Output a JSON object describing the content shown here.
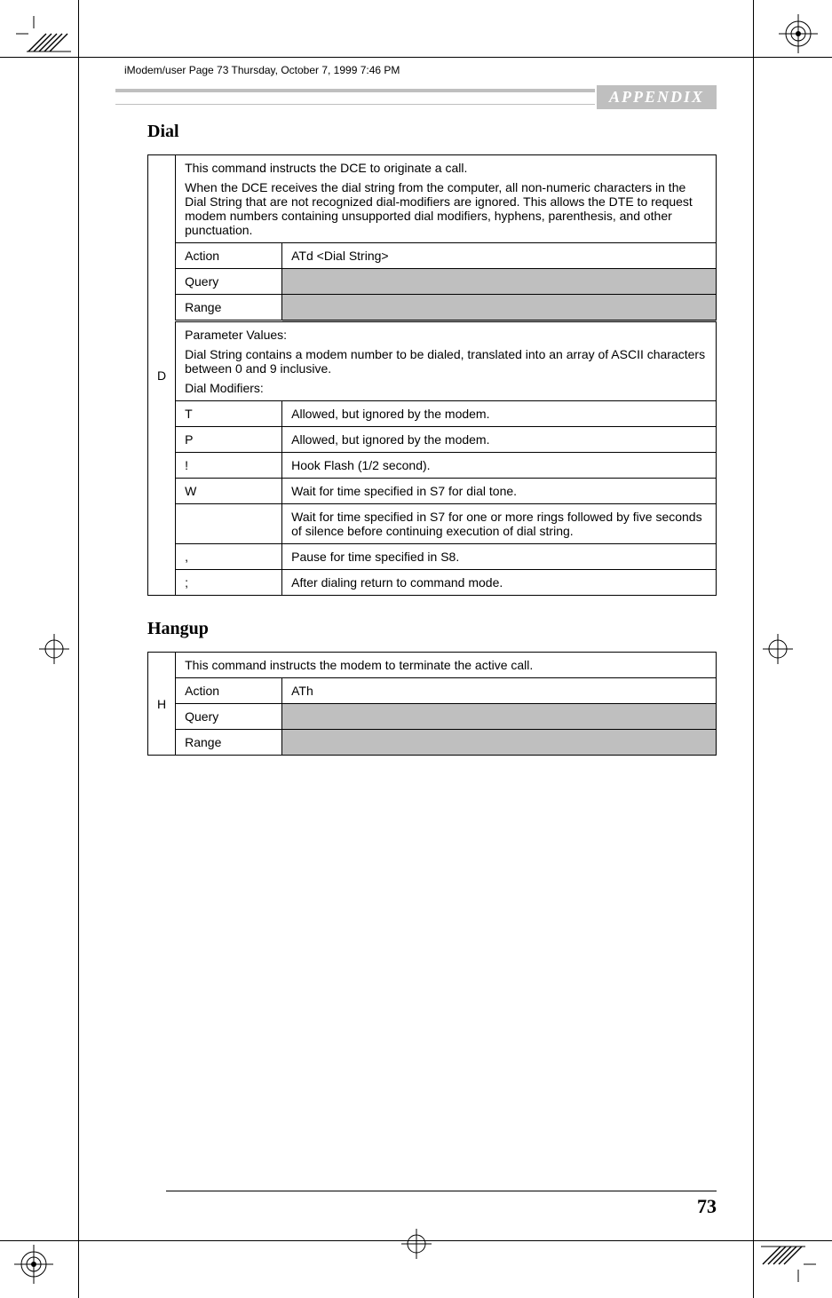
{
  "header_line": "iModem/user  Page 73  Thursday, October 7, 1999  7:46 PM",
  "appendix_label": "APPENDIX",
  "sections": {
    "dial": {
      "title": "Dial",
      "letter": "D",
      "desc_p1": "This command instructs the DCE to originate a call.",
      "desc_p2": "When the DCE receives the dial string from the computer, all non-numeric characters in the Dial String that are not recognized dial-modifiers are ignored. This allows the DTE to request modem numbers containing unsupported dial modifiers, hyphens, parenthesis, and other punctuation.",
      "action_label": "Action",
      "action_value": "ATd <Dial String>",
      "query_label": "Query",
      "range_label": "Range",
      "param_header": "Parameter Values:",
      "param_desc": "Dial String contains a modem number to be dialed, translated into an array of ASCII characters between 0 and 9 inclusive.",
      "mod_header": "Dial Modifiers:",
      "rows": [
        {
          "key": "T",
          "val": "Allowed, but ignored by the modem."
        },
        {
          "key": "P",
          "val": "Allowed, but ignored by the modem."
        },
        {
          "key": "!",
          "val": "Hook Flash (1/2 second)."
        },
        {
          "key": "W",
          "val": "Wait for time specified in S7 for dial tone."
        },
        {
          "key": "",
          "val": "Wait for time specified in S7 for one or more rings followed by five seconds of silence before continuing execution of dial string."
        },
        {
          "key": ",",
          "val": "Pause for time specified in S8."
        },
        {
          "key": ";",
          "val": "After dialing return to command mode."
        }
      ]
    },
    "hangup": {
      "title": "Hangup",
      "letter": "H",
      "desc": "This command instructs the modem to terminate the active call.",
      "action_label": "Action",
      "action_value": "ATh",
      "query_label": "Query",
      "range_label": "Range"
    }
  },
  "page_number": "73"
}
